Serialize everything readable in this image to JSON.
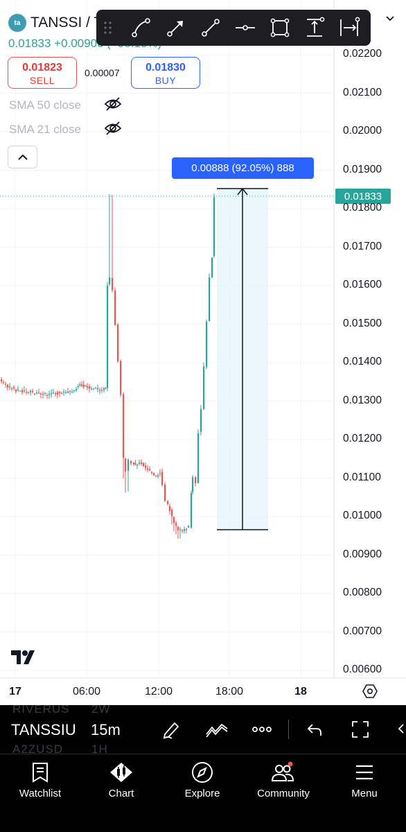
{
  "header": {
    "logo_text": "ta",
    "symbol": "TANSSI / T",
    "price_change": "0.01833 +0.00906 (+98.13%)"
  },
  "trade": {
    "sell_price": "0.01823",
    "sell_label": "SELL",
    "spread": "0.00007",
    "buy_price": "0.01830",
    "buy_label": "BUY"
  },
  "indicators": [
    {
      "label": "SMA 50 close"
    },
    {
      "label": "SMA 21 close"
    }
  ],
  "drawing_toolbar": {
    "tools": [
      "trend-line-icon",
      "arrow-line-icon",
      "ray-icon",
      "horizontal-line-icon",
      "rectangle-icon",
      "price-range-icon",
      "date-range-icon"
    ]
  },
  "chart": {
    "measure_label": "0.00888 (92.05%) 888",
    "last_price_label": "0.01833",
    "y_axis": [
      "0.02200",
      "0.02100",
      "0.02000",
      "0.01900",
      "0.01800",
      "0.01700",
      "0.01600",
      "0.01500",
      "0.01400",
      "0.01300",
      "0.01200",
      "0.01100",
      "0.01000",
      "0.00900",
      "0.00800",
      "0.00700",
      "0.00600"
    ],
    "x_axis": [
      "17",
      "06:00",
      "12:00",
      "18:00",
      "18"
    ],
    "up_color": "#26a69a",
    "down_color": "#ef5350"
  },
  "symbol_bar": {
    "symbol": "TANSSIU",
    "timeframe": "15m",
    "ghost_top_symbol": "RIVERUS",
    "ghost_top_tf": "2W",
    "ghost_bottom_symbol": "A2ZUSD",
    "ghost_bottom_tf": "1H"
  },
  "bottom_nav": {
    "items": [
      {
        "label": "Watchlist"
      },
      {
        "label": "Chart"
      },
      {
        "label": "Explore"
      },
      {
        "label": "Community"
      },
      {
        "label": "Menu"
      }
    ]
  }
}
